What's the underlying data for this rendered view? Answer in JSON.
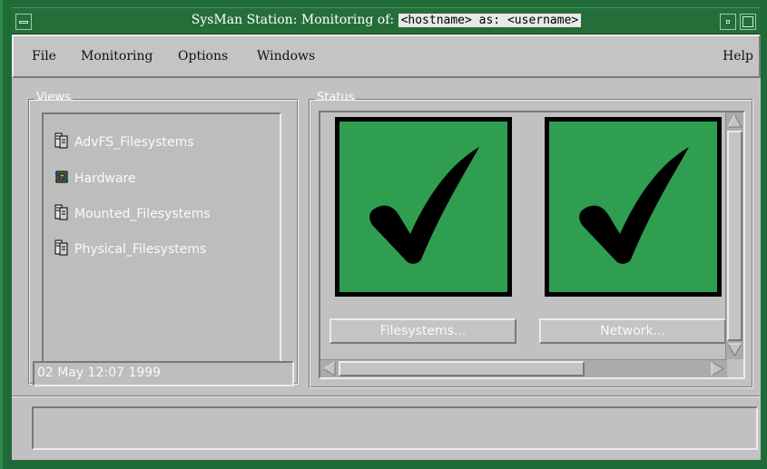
{
  "window": {
    "title_prefix": "SysMan Station:  Monitoring of:",
    "title_highlight": "<hostname> as: <username>"
  },
  "menubar": {
    "items": [
      "File",
      "Monitoring",
      "Options",
      "Windows"
    ],
    "help": "Help"
  },
  "views": {
    "label": "Views",
    "items": [
      {
        "label": "AdvFS_Filesystems",
        "icon": "filesystem-icon"
      },
      {
        "label": "Hardware",
        "icon": "hardware-icon"
      },
      {
        "label": "Mounted_Filesystems",
        "icon": "filesystem-icon"
      },
      {
        "label": "Physical_Filesystems",
        "icon": "filesystem-icon"
      }
    ],
    "timestamp": "02 May 12:07 1999"
  },
  "status": {
    "label": "Status",
    "tiles": [
      {
        "state": "ok",
        "button": "Filesystems..."
      },
      {
        "state": "ok",
        "button": "Network..."
      }
    ]
  },
  "statusbar": {
    "text": ""
  },
  "colors": {
    "frame_green": "#1f6b37",
    "tile_green": "#2f9e50",
    "panel_gray": "#c1c1c1"
  }
}
